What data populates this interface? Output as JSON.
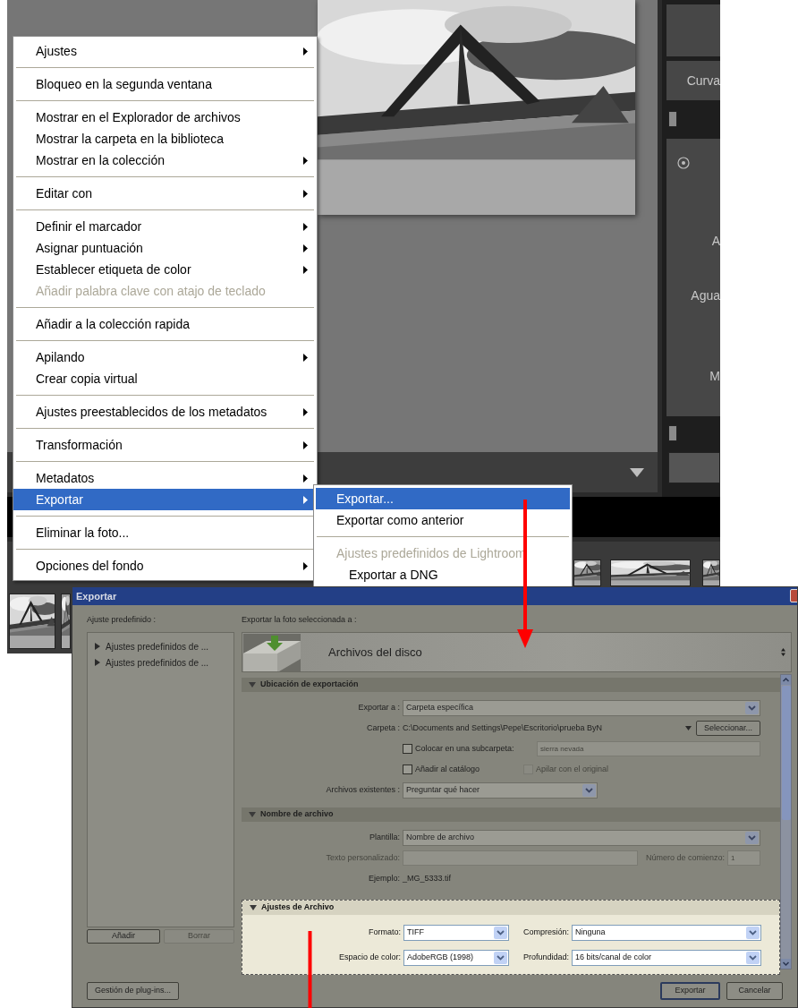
{
  "photo_viewer": {
    "panel_header": "Curva",
    "panel_labels": [
      "A",
      "Agua",
      "M"
    ]
  },
  "context_menu": {
    "groups": [
      [
        {
          "label": "Ajustes",
          "submenu": true,
          "disabled": false,
          "selected": false
        }
      ],
      [
        {
          "label": "Bloqueo en la segunda ventana",
          "submenu": false,
          "disabled": false,
          "selected": false
        }
      ],
      [
        {
          "label": "Mostrar en el Explorador de archivos",
          "submenu": false,
          "disabled": false,
          "selected": false
        },
        {
          "label": "Mostrar la carpeta en la biblioteca",
          "submenu": false,
          "disabled": false,
          "selected": false
        },
        {
          "label": "Mostrar en la colección",
          "submenu": true,
          "disabled": false,
          "selected": false
        }
      ],
      [
        {
          "label": "Editar con",
          "submenu": true,
          "disabled": false,
          "selected": false
        }
      ],
      [
        {
          "label": "Definir el marcador",
          "submenu": true,
          "disabled": false,
          "selected": false
        },
        {
          "label": "Asignar puntuación",
          "submenu": true,
          "disabled": false,
          "selected": false
        },
        {
          "label": "Establecer etiqueta de color",
          "submenu": true,
          "disabled": false,
          "selected": false
        },
        {
          "label": "Añadir palabra clave con atajo de teclado",
          "submenu": false,
          "disabled": true,
          "selected": false
        }
      ],
      [
        {
          "label": "Añadir a la colección rapida",
          "submenu": false,
          "disabled": false,
          "selected": false
        }
      ],
      [
        {
          "label": "Apilando",
          "submenu": true,
          "disabled": false,
          "selected": false
        },
        {
          "label": "Crear copia virtual",
          "submenu": false,
          "disabled": false,
          "selected": false
        }
      ],
      [
        {
          "label": "Ajustes preestablecidos de los metadatos",
          "submenu": true,
          "disabled": false,
          "selected": false
        }
      ],
      [
        {
          "label": "Transformación",
          "submenu": true,
          "disabled": false,
          "selected": false
        }
      ],
      [
        {
          "label": "Metadatos",
          "submenu": true,
          "disabled": false,
          "selected": false
        },
        {
          "label": "Exportar",
          "submenu": true,
          "disabled": false,
          "selected": true
        }
      ],
      [
        {
          "label": "Eliminar la foto...",
          "submenu": false,
          "disabled": false,
          "selected": false
        }
      ],
      [
        {
          "label": "Opciones del fondo",
          "submenu": true,
          "disabled": false,
          "selected": false
        }
      ]
    ]
  },
  "submenu": {
    "groups": [
      [
        {
          "label": "Exportar...",
          "kind": "item",
          "selected": true
        },
        {
          "label": "Exportar como anterior",
          "kind": "item",
          "selected": false
        }
      ],
      [
        {
          "label": "Ajustes predefinidos de Lightroom",
          "kind": "header",
          "selected": false
        },
        {
          "label": "Exportar a DNG",
          "kind": "preset",
          "selected": false
        }
      ]
    ]
  },
  "export_dialog": {
    "title": "Exportar",
    "preset_label": "Ajuste predefinido :",
    "presets": [
      {
        "label": "Ajustes predefinidos de ...",
        "expanded": false
      },
      {
        "label": "Ajustes predefinidos de ...",
        "expanded": false
      }
    ],
    "add_button": "Añadir",
    "remove_button": {
      "label": "Borrar",
      "disabled": true
    },
    "destination_label": "Exportar la foto seleccionada a :",
    "destination": "Archivos del disco",
    "sections": [
      {
        "title": "Ubicación de exportación",
        "expanded": true,
        "highlighted": false,
        "rows": [
          {
            "kind": "select",
            "label": "Exportar a :",
            "value": "Carpeta específica"
          },
          {
            "kind": "path",
            "label": "Carpeta :",
            "value": "C:\\Documents and Settings\\Pepe\\Escritorio\\prueba ByN",
            "button": "Seleccionar..."
          },
          {
            "kind": "checkbox_field",
            "label": "Colocar en una subcarpeta:",
            "checked": false,
            "placeholder": "sierra nevada"
          },
          {
            "kind": "checkboxes",
            "items": [
              {
                "label": "Añadir al catálogo",
                "checked": false,
                "disabled": false
              },
              {
                "label": "Apilar con el original",
                "checked": false,
                "disabled": true
              }
            ]
          },
          {
            "kind": "select_short",
            "label": "Archivos existentes :",
            "value": "Preguntar qué hacer"
          }
        ]
      },
      {
        "title": "Nombre de archivo",
        "expanded": true,
        "highlighted": false,
        "rows": [
          {
            "kind": "select",
            "label": "Plantilla:",
            "value": "Nombre de archivo"
          },
          {
            "kind": "disabled_pair",
            "label": "Texto personalizado:",
            "label2": "Número de comienzo:",
            "value2": "1"
          },
          {
            "kind": "example",
            "label": "Ejemplo:",
            "value": "_MG_5333.tif"
          }
        ]
      },
      {
        "title": "Ajustes de Archivo",
        "expanded": true,
        "highlighted": true,
        "rows": [
          {
            "kind": "select_pair",
            "label": "Formato:",
            "value": "TIFF",
            "label2": "Compresión:",
            "value2": "Ninguna"
          },
          {
            "kind": "select_pair",
            "label": "Espacio de color:",
            "value": "AdobeRGB (1998)",
            "label2": "Profundidad:",
            "value2": "16 bits/canal de color"
          }
        ]
      }
    ],
    "plugin_button": "Gestión de plug-ins...",
    "export_button": "Exportar",
    "cancel_button": "Cancelar"
  }
}
